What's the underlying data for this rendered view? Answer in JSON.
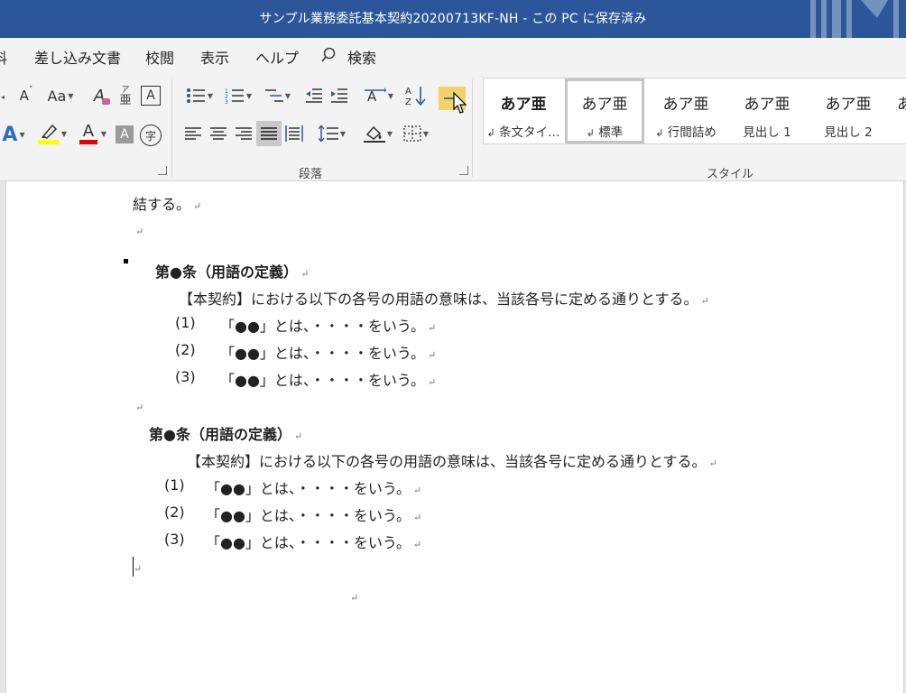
{
  "window": {
    "title": "サンプル業務委託基本契約20200713KF-NH - この PC に保存済み"
  },
  "tabs": [
    "料",
    "差し込み文書",
    "校閲",
    "表示",
    "ヘルプ"
  ],
  "search": {
    "label": "検索"
  },
  "ribbon": {
    "font_group_icons": [
      "case-icon",
      "clear-format-icon",
      "phonetic-icon",
      "char-border-icon",
      "text-effect-icon",
      "highlight-icon",
      "font-color-icon",
      "shading-icon",
      "enclose-char-icon"
    ],
    "font_glyphs": {
      "grow": "A",
      "shrink": "A",
      "case": "Aa",
      "clear": "A",
      "phonetic_top": "ア",
      "phonetic_bottom": "亜",
      "border": "A",
      "effect": "A",
      "highlight": "ℐ",
      "color": "A",
      "shade": "A",
      "enclose": "字"
    },
    "paragraph_label": "段落",
    "styles_label": "スタイル",
    "colors": {
      "highlight": "#ffff00",
      "font_color": "#e00000",
      "tab_accent": "#2b579a"
    }
  },
  "styles": [
    {
      "sample": "あア亜",
      "name": "条文タイ…",
      "mark": "↲",
      "bold": true
    },
    {
      "sample": "あア亜",
      "name": "標準",
      "mark": "↲",
      "bold": false,
      "selected": true
    },
    {
      "sample": "あア亜",
      "name": "行間詰め",
      "mark": "↲",
      "bold": false
    },
    {
      "sample": "あア亜",
      "name": "見出し 1",
      "mark": "",
      "bold": false
    },
    {
      "sample": "あア亜",
      "name": "見出し 2",
      "mark": "",
      "bold": false
    },
    {
      "sample": "あ",
      "name": "",
      "mark": "",
      "bold": false
    }
  ],
  "document": {
    "mark": "↵",
    "lines": [
      {
        "text": "結する。"
      },
      {
        "text": ""
      },
      {
        "text": "第●条（用語の定義）"
      },
      {
        "text": "【本契約】における以下の各号の用語の意味は、当該各号に定める通りとする。"
      },
      {
        "num": "(1)",
        "text": "「●●」とは、・・・・をいう。"
      },
      {
        "num": "(2)",
        "text": "「●●」とは、・・・・をいう。"
      },
      {
        "num": "(3)",
        "text": "「●●」とは、・・・・をいう。"
      },
      {
        "text": ""
      },
      {
        "text": "第●条（用語の定義）"
      },
      {
        "text": "【本契約】における以下の各号の用語の意味は、当該各号に定める通りとする。"
      },
      {
        "num": "(1)",
        "text": "「●●」とは、・・・・をいう。"
      },
      {
        "num": "(2)",
        "text": "「●●」とは、・・・・をいう。"
      },
      {
        "num": "(3)",
        "text": "「●●」とは、・・・・をいう。"
      },
      {
        "text": ""
      },
      {
        "text": ""
      }
    ]
  }
}
